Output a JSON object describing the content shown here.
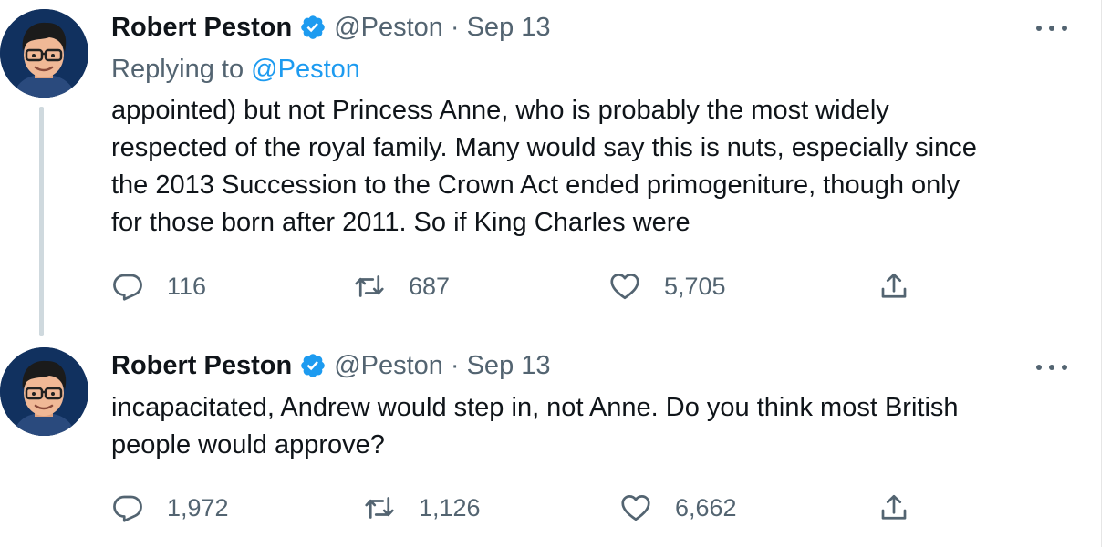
{
  "colors": {
    "accent": "#1d9bf0",
    "secondary_text": "#536471",
    "avatar_bg": "#11315f"
  },
  "tweets": [
    {
      "author_name": "Robert Peston",
      "handle": "@Peston",
      "separator": "·",
      "date": "Sep 13",
      "replying_prefix": "Replying to",
      "replying_handle": "@Peston",
      "text_lines": [
        "appointed) but not Princess Anne, who is probably the most widely",
        "respected of the royal family. Many would say this is nuts, especially since",
        "the 2013 Succession to the Crown Act ended primogeniture, though only",
        "for those born after 2011. So if King Charles were"
      ],
      "replies": "116",
      "retweets": "687",
      "likes": "5,705"
    },
    {
      "author_name": "Robert Peston",
      "handle": "@Peston",
      "separator": "·",
      "date": "Sep 13",
      "text_lines": [
        "incapacitated, Andrew would step in, not Anne. Do you think most British",
        "people would approve?"
      ],
      "replies": "1,972",
      "retweets": "1,126",
      "likes": "6,662"
    }
  ],
  "icons": {
    "verified": "verified-badge-icon",
    "more": "more-dots-icon",
    "reply": "reply-bubble-icon",
    "retweet": "retweet-icon",
    "like": "heart-icon",
    "share": "share-upload-icon"
  }
}
